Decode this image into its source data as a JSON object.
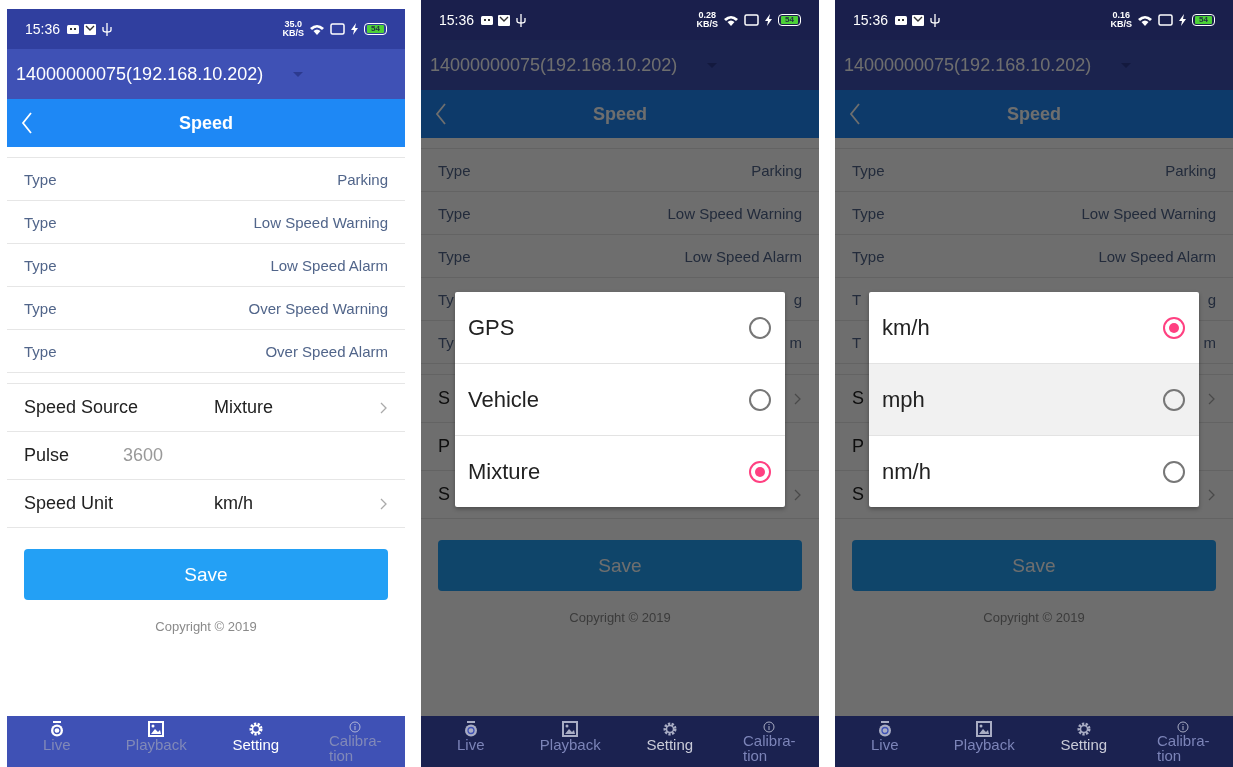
{
  "screens": [
    {
      "status": {
        "time": "15:36",
        "net_speed": "35.0",
        "net_unit": "KB/S",
        "battery": "54"
      },
      "device": "14000000075(192.168.10.202)",
      "title": "Speed",
      "type_rows": [
        {
          "label": "Type",
          "value": "Parking"
        },
        {
          "label": "Type",
          "value": "Low Speed Warning"
        },
        {
          "label": "Type",
          "value": "Low Speed Alarm"
        },
        {
          "label": "Type",
          "value": "Over Speed Warning"
        },
        {
          "label": "Type",
          "value": "Over Speed Alarm"
        }
      ],
      "settings": [
        {
          "kind": "select",
          "label": "Speed Source",
          "value": "Mixture"
        },
        {
          "kind": "input",
          "label": "Pulse",
          "placeholder": "3600"
        },
        {
          "kind": "select",
          "label": "Speed Unit",
          "value": "km/h"
        }
      ],
      "save": "Save",
      "copyright": "Copyright © 2019",
      "nav": [
        {
          "kind": "live",
          "label": "Live",
          "selected": false
        },
        {
          "kind": "playback",
          "label": "Playback",
          "selected": false
        },
        {
          "kind": "setting",
          "label": "Setting",
          "selected": true
        },
        {
          "kind": "info",
          "label": "Calibra-\ntion",
          "selected": false
        }
      ]
    },
    {
      "status": {
        "time": "15:36",
        "net_speed": "0.28",
        "net_unit": "KB/S",
        "battery": "54"
      },
      "device": "14000000075(192.168.10.202)",
      "title": "Speed",
      "type_rows": [
        {
          "label": "Type",
          "value": "Parking"
        },
        {
          "label": "Type",
          "value": "Low Speed Warning"
        },
        {
          "label": "Type",
          "value": "Low Speed Alarm"
        },
        {
          "label": "Ty",
          "value": "g"
        },
        {
          "label": "Ty",
          "value": "m"
        }
      ],
      "settings": [
        {
          "kind": "select",
          "label": "S"
        },
        {
          "kind": "input",
          "label": "P"
        },
        {
          "kind": "select",
          "label": "S"
        }
      ],
      "save": "Save",
      "copyright": "Copyright © 2019",
      "nav": [
        {
          "kind": "live",
          "label": "Live",
          "selected": false
        },
        {
          "kind": "playback",
          "label": "Playback",
          "selected": false
        },
        {
          "kind": "setting",
          "label": "Setting",
          "selected": true
        },
        {
          "kind": "info",
          "label": "Calibra-\ntion",
          "selected": false
        }
      ],
      "dialog": {
        "options": [
          {
            "label": "GPS",
            "selected": false,
            "pressed": false
          },
          {
            "label": "Vehicle",
            "selected": false,
            "pressed": false
          },
          {
            "label": "Mixture",
            "selected": true,
            "pressed": false
          }
        ]
      }
    },
    {
      "status": {
        "time": "15:36",
        "net_speed": "0.16",
        "net_unit": "KB/S",
        "battery": "54"
      },
      "device": "14000000075(192.168.10.202)",
      "title": "Speed",
      "type_rows": [
        {
          "label": "Type",
          "value": "Parking"
        },
        {
          "label": "Type",
          "value": "Low Speed Warning"
        },
        {
          "label": "Type",
          "value": "Low Speed Alarm"
        },
        {
          "label": "T",
          "value": "g"
        },
        {
          "label": "T",
          "value": "m"
        }
      ],
      "settings": [
        {
          "kind": "select",
          "label": "S"
        },
        {
          "kind": "input",
          "label": "P"
        },
        {
          "kind": "select",
          "label": "S"
        }
      ],
      "save": "Save",
      "copyright": "Copyright © 2019",
      "nav": [
        {
          "kind": "live",
          "label": "Live",
          "selected": false
        },
        {
          "kind": "playback",
          "label": "Playback",
          "selected": false
        },
        {
          "kind": "setting",
          "label": "Setting",
          "selected": true
        },
        {
          "kind": "info",
          "label": "Calibra-\ntion",
          "selected": false
        }
      ],
      "dialog": {
        "options": [
          {
            "label": "km/h",
            "selected": true,
            "pressed": false
          },
          {
            "label": "mph",
            "selected": false,
            "pressed": true
          },
          {
            "label": "nm/h",
            "selected": false,
            "pressed": false
          }
        ]
      }
    }
  ]
}
